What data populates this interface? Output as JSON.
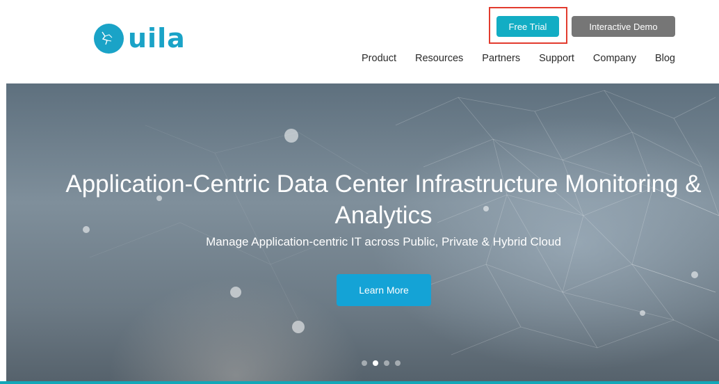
{
  "brand": {
    "name": "uila",
    "color": "#1aa3c7"
  },
  "header": {
    "free_trial": "Free Trial",
    "interactive_demo": "Interactive Demo",
    "nav": [
      "Product",
      "Resources",
      "Partners",
      "Support",
      "Company",
      "Blog"
    ]
  },
  "hero": {
    "title_line1": "Application-Centric Data Center Infrastructure Monitoring &",
    "title_line2": "Analytics",
    "subtitle": "Manage Application-centric IT across Public, Private & Hybrid Cloud",
    "cta": "Learn More",
    "slides": 4,
    "active_slide": 2
  },
  "colors": {
    "accent": "#12adc4",
    "demo_button": "#767676",
    "highlight": "#e23b2e",
    "cta": "#14a3d6"
  }
}
